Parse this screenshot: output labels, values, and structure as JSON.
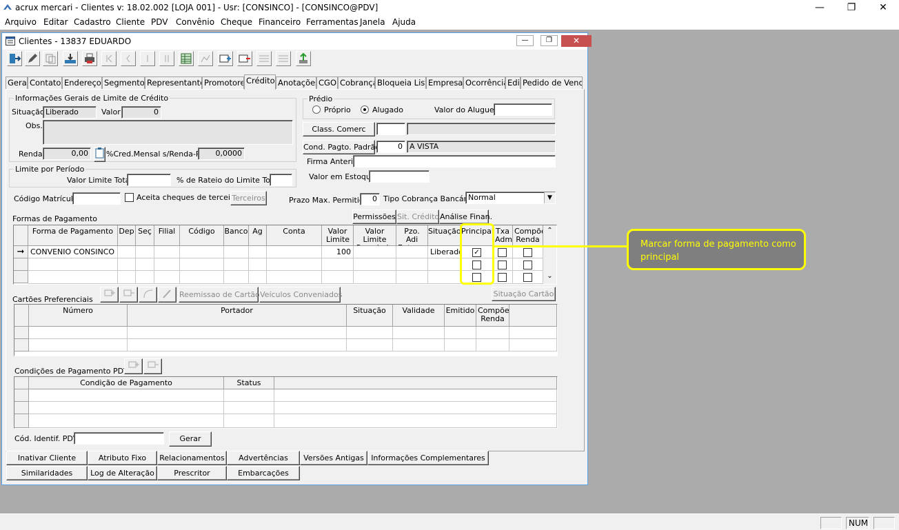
{
  "app": {
    "title": "acrux mercari - Clientes  v: 18.02.002  [LOJA 001] - Usr: [CONSINCO] - [CONSINCO@PDV]",
    "controls": {
      "minimize": "—",
      "restore": "❐",
      "close": "✕"
    }
  },
  "menu": [
    "Arquivo",
    "Editar",
    "Cadastro",
    "Cliente",
    "PDV",
    "Convênio",
    "Cheque",
    "Financeiro",
    "Ferramentas",
    "Janela",
    "Ajuda"
  ],
  "window": {
    "title": "Clientes - 13837 EDUARDO"
  },
  "tabs": [
    "Geral",
    "Contatos",
    "Endereços",
    "Segmentos",
    "Representantes",
    "Promotores",
    "Créditos",
    "Anotações",
    "CGO",
    "Cobrança",
    "Bloqueia Lista",
    "Empresas",
    "Ocorrência",
    "Edi",
    "Pedido de Venda"
  ],
  "active_tab": "Créditos",
  "credit_info": {
    "group_title": "Informações Gerais de Limite de Crédito",
    "situacao_label": "Situação",
    "situacao_value": "Liberado",
    "valor_label": "Valor",
    "valor_value": "0",
    "obs_label": "Obs.",
    "renda_label": "Renda",
    "renda_value": "0,00",
    "cred_label": "%Cred.Mensal s/Renda-PF",
    "cred_value": "0,0000"
  },
  "limite": {
    "group_title": "Limite por Período",
    "valor_total_label": "Valor Limite Total",
    "rateio_label": "% de Rateio do Limite Total"
  },
  "predio": {
    "group_title": "Prédio",
    "opt_proprio": "Próprio",
    "opt_alugado": "Alugado",
    "aluguel_label": "Valor do Aluguel"
  },
  "right_fields": {
    "class_comerc_button": "Class. Comerc",
    "cond_pagto_button": "Cond. Pagto. Padrão",
    "cond_pagto_code": "0",
    "cond_pagto_desc": "A VISTA",
    "firma_label": "Firma Anterior",
    "estoque_label": "Valor em Estoque",
    "prazo_label": "Prazo Max. Permitido",
    "prazo_value": "0",
    "tipo_cobranca_label": "Tipo Cobrança Bancária",
    "tipo_cobranca_value": "Normal"
  },
  "misc": {
    "codigo_matricula_label": "Código Matrícula",
    "aceita_cheques_label": "Aceita cheques de terceiros",
    "terceiros_button": "Terceiros"
  },
  "formas": {
    "title": "Formas de Pagamento",
    "btn_permissoes": "Permissões",
    "btn_sit_credito": "Sit. Crédito",
    "btn_analise": "Análise Finan.",
    "columns": [
      "Forma de Pagamento",
      "Dep",
      "Seç",
      "Filial",
      "Código",
      "Banco",
      "Ag",
      "Conta",
      "Valor Limite",
      "Valor Limite Parcelado",
      "Pzo. Adi Entrega",
      "Situação",
      "Principal",
      "Txa Adm",
      "Compõe Renda"
    ],
    "row": {
      "forma": "CONVENIO CONSINCO",
      "valor_limite": "100",
      "situacao": "Liberado"
    }
  },
  "cartoes": {
    "title": "Cartões Preferenciais",
    "btn_reemissao": "Reemissao de Cartão",
    "btn_veiculos": "Veículos Conveniados",
    "btn_situacao": "Situação Cartão",
    "columns": [
      "Número",
      "Portador",
      "Situação",
      "Validade",
      "Emitido",
      "Compõe Renda"
    ]
  },
  "condicoes": {
    "title": "Condições de Pagamento PDV",
    "columns": [
      "Condição de Pagamento",
      "Status"
    ]
  },
  "cod_identif": {
    "label": "Cód. Identif. PDV",
    "button": "Gerar"
  },
  "bottom_buttons_row1": [
    "Inativar Cliente",
    "Atributo Fixo",
    "Relacionamentos",
    "Advertências",
    "Versões Antigas",
    "Informações Complementares"
  ],
  "bottom_buttons_row2": [
    "Similaridades",
    "Log de Alteração",
    "Prescritor",
    "Embarcações"
  ],
  "annotation": {
    "text": "Marcar forma de pagamento como principal",
    "color": "#ffff00"
  },
  "status": {
    "num": "NUM"
  }
}
